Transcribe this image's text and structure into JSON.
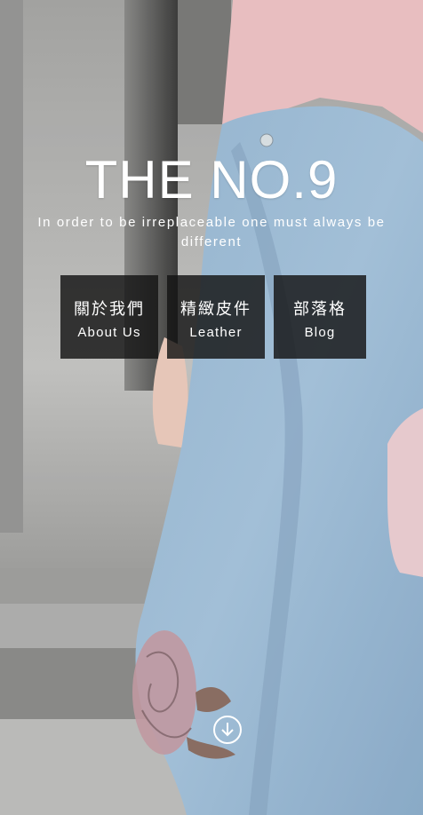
{
  "hero": {
    "title": "THE NO.9",
    "tagline": "In order to be irreplaceable one must always be different"
  },
  "nav": {
    "items": [
      {
        "zh": "關於我們",
        "en": "About Us"
      },
      {
        "zh": "精緻皮件",
        "en": "Leather"
      },
      {
        "zh": "部落格",
        "en": "Blog"
      }
    ]
  },
  "icons": {
    "scroll": "arrow-down-circle-icon"
  }
}
